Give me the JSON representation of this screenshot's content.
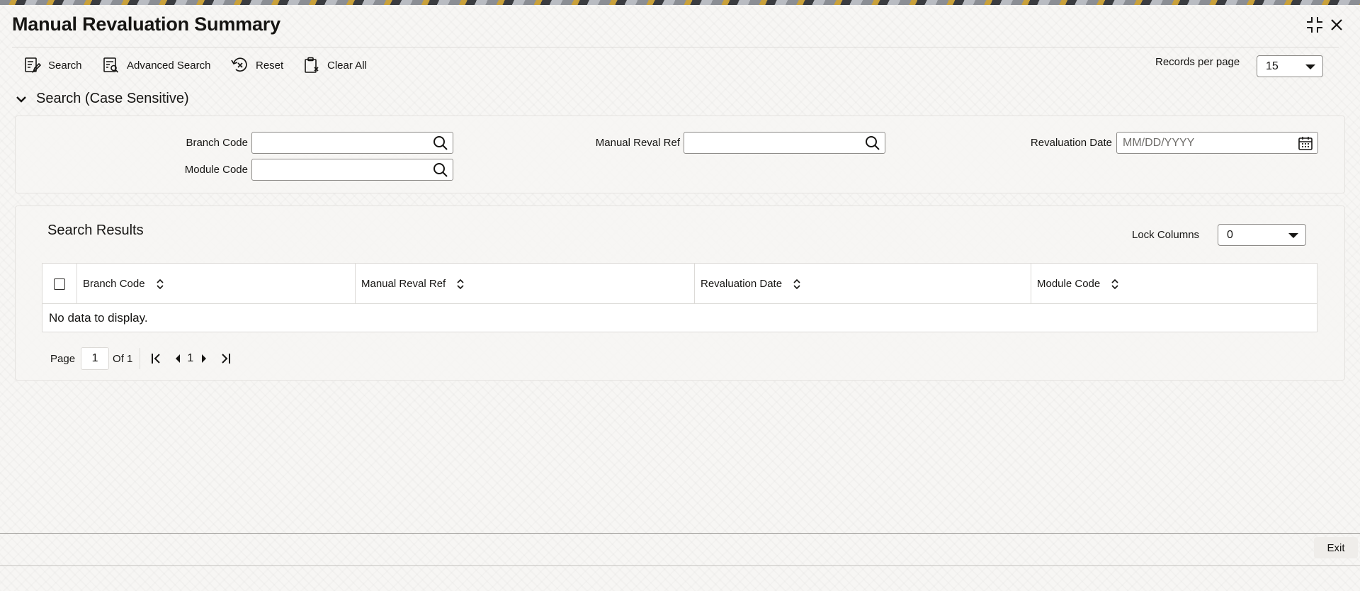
{
  "window": {
    "title": "Manual Revaluation Summary",
    "icons": {
      "minimize": "collapse-icon",
      "close": "close-icon"
    }
  },
  "toolbar": {
    "search_label": "Search",
    "advanced_search_label": "Advanced Search",
    "reset_label": "Reset",
    "clear_all_label": "Clear All"
  },
  "records_per_page": {
    "label": "Records per page",
    "value": "15"
  },
  "search_section": {
    "title": "Search (Case Sensitive)",
    "fields": {
      "branch_code": {
        "label": "Branch Code",
        "value": "",
        "icon": "search-icon"
      },
      "manual_reval_ref": {
        "label": "Manual Reval Ref",
        "value": "",
        "icon": "search-icon"
      },
      "revaluation_date": {
        "label": "Revaluation Date",
        "value": "",
        "placeholder": "MM/DD/YYYY",
        "icon": "calendar-icon"
      },
      "module_code": {
        "label": "Module Code",
        "value": "",
        "icon": "search-icon"
      }
    }
  },
  "results": {
    "title": "Search Results",
    "lock_columns": {
      "label": "Lock Columns",
      "value": "0"
    },
    "columns": [
      "Branch Code",
      "Manual Reval Ref",
      "Revaluation Date",
      "Module Code"
    ],
    "rows": [],
    "empty_message": "No data to display."
  },
  "pagination": {
    "page_label": "Page",
    "current_page": "1",
    "of_label": "Of 1",
    "page_number": "1"
  },
  "footer": {
    "exit_label": "Exit"
  },
  "colors": {
    "text": "#161513",
    "border": "#8d8b88",
    "panel": "#f6f5f3"
  }
}
